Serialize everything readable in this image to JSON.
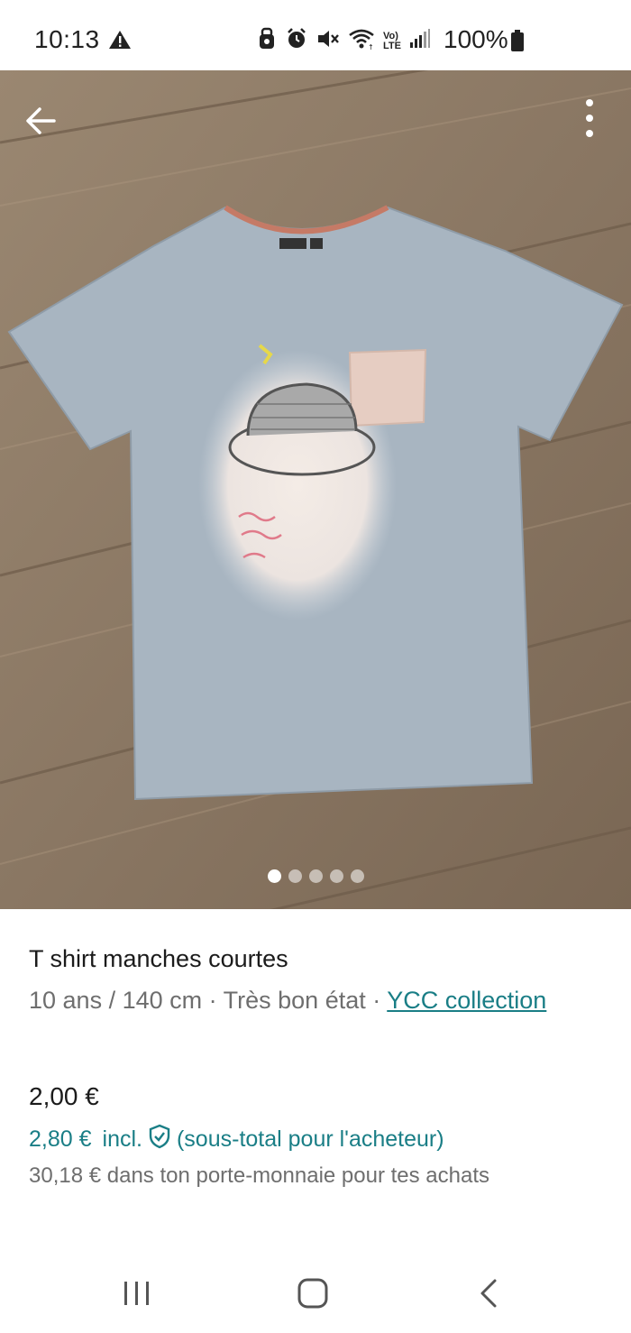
{
  "status_bar": {
    "time": "10:13",
    "battery_percent": "100%",
    "icons": [
      "warning-icon",
      "alarm-icon",
      "clock-icon",
      "mute-icon",
      "wifi-icon",
      "volte-icon",
      "signal-icon",
      "battery-icon"
    ],
    "volte_label_top": "Vo)",
    "volte_label_bottom": "LTE"
  },
  "photo": {
    "carousel_count": 5,
    "active_index": 0
  },
  "item": {
    "title": "T shirt manches courtes",
    "size": "10 ans / 140 cm",
    "separator": " · ",
    "condition": "Très bon état",
    "brand": "YCC collection",
    "price": "2,00 €",
    "buyer_price": "2,80 €",
    "buyer_incl": "incl.",
    "buyer_note": "(sous-total pour l'acheteur)",
    "wallet_text": "30,18 € dans ton porte-monnaie pour tes achats"
  },
  "colors": {
    "accent": "#1a7e86",
    "text_primary": "#1b1b1b",
    "text_secondary": "#6e6e6e"
  }
}
